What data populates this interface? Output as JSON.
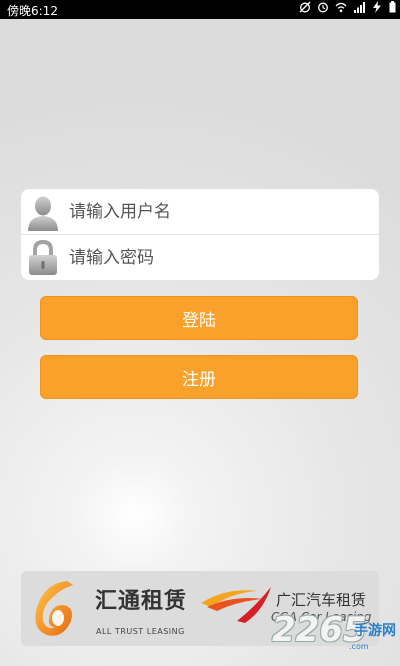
{
  "status_bar": {
    "time": "傍晚6:12",
    "icons": [
      "alarm-off-icon",
      "alarm-icon",
      "wifi-icon",
      "signal-icon",
      "charging-icon"
    ]
  },
  "login": {
    "username_placeholder": "请输入用户名",
    "password_placeholder": "请输入密码",
    "login_label": "登陆",
    "register_label": "注册"
  },
  "banner": {
    "brand1_cn": "汇通租赁",
    "brand1_en": "ALL TRUST LEASING",
    "brand2_cn": "广汇汽车租赁",
    "brand2_en": "CGA Car Leasing"
  },
  "watermark": {
    "number": "2265",
    "site": "手游网",
    "domain": ".com"
  },
  "colors": {
    "button": "#f9a12a",
    "status_bar": "#000000",
    "card": "#ffffff"
  }
}
